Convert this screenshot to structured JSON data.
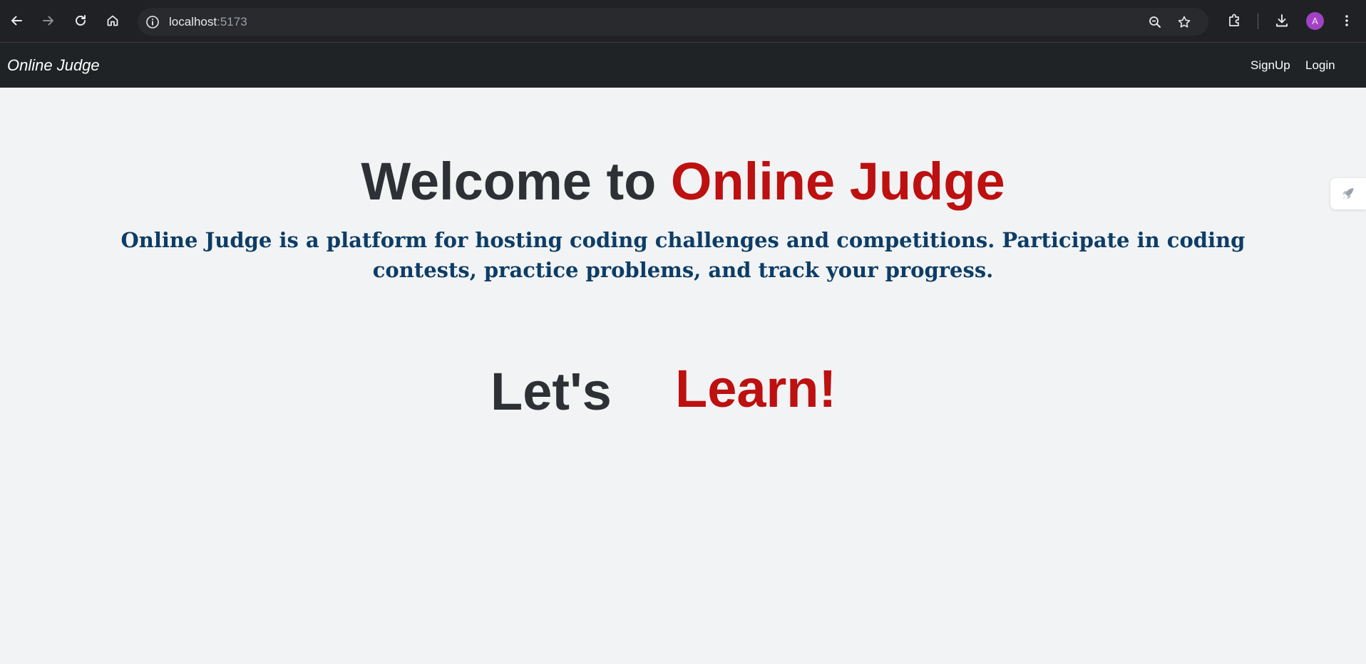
{
  "browser": {
    "url_host": "localhost",
    "url_port": ":5173",
    "avatar_letter": "A",
    "icons": {
      "back": "arrow-left-icon",
      "forward": "arrow-right-icon",
      "reload": "reload-icon",
      "home": "home-icon",
      "site_info": "info-icon",
      "zoom": "zoom-icon",
      "bookmark": "star-icon",
      "extensions": "puzzle-icon",
      "downloads": "download-icon",
      "menu": "kebab-menu-icon"
    }
  },
  "navbar": {
    "brand": "Online Judge",
    "links": [
      {
        "label": "SignUp"
      },
      {
        "label": "Login"
      }
    ]
  },
  "hero": {
    "title_prefix": "Welcome to ",
    "title_accent": "Online Judge",
    "description": "Online Judge is a platform for hosting coding challenges and competitions. Participate in coding contests, practice problems, and track your progress.",
    "lets": "Let's",
    "learn": "Learn!"
  },
  "side_widget": {
    "icon": "rocket-icon"
  },
  "colors": {
    "background": "#f2f3f4",
    "navbar": "#1f2326",
    "heading_dark": "#2d3136",
    "accent_red": "#bd1010",
    "description_blue": "#0d3d66"
  }
}
